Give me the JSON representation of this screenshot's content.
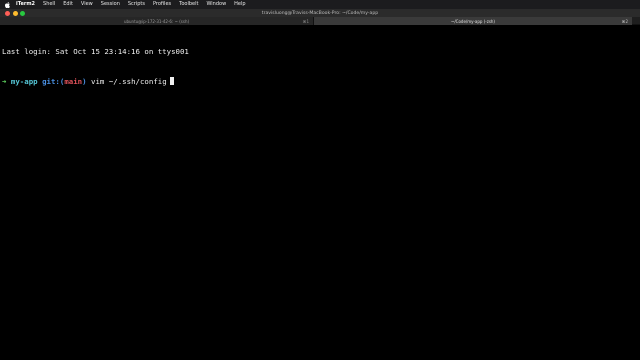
{
  "menubar": {
    "apple_icon": "apple-logo",
    "items": [
      "iTerm2",
      "Shell",
      "Edit",
      "View",
      "Session",
      "Scripts",
      "Profiles",
      "Toolbelt",
      "Window",
      "Help"
    ]
  },
  "window": {
    "title": "travisluong@Traviss-MacBook-Pro: ~/Code/my-app"
  },
  "tabs": [
    {
      "label": "ubuntu@ip-172-31-42-6: ~ (ssh)",
      "shortcut": "⌘1",
      "active": false
    },
    {
      "label": "~/Code/my-app (-zsh)",
      "shortcut": "⌘2",
      "active": true
    }
  ],
  "terminal": {
    "last_login": "Last login: Sat Oct 15 23:14:16 on ttys001",
    "prompt_arrow": "➜",
    "prompt_dir": "my-app",
    "prompt_git": "git:(",
    "prompt_branch": "main",
    "prompt_git_close": ")",
    "command": "vim ~/.ssh/config"
  },
  "colors": {
    "prompt_arrow": "#5fd35f",
    "prompt_dir": "#56c8d8",
    "prompt_git": "#4a90e2",
    "prompt_branch": "#e0525a",
    "background": "#000000"
  }
}
